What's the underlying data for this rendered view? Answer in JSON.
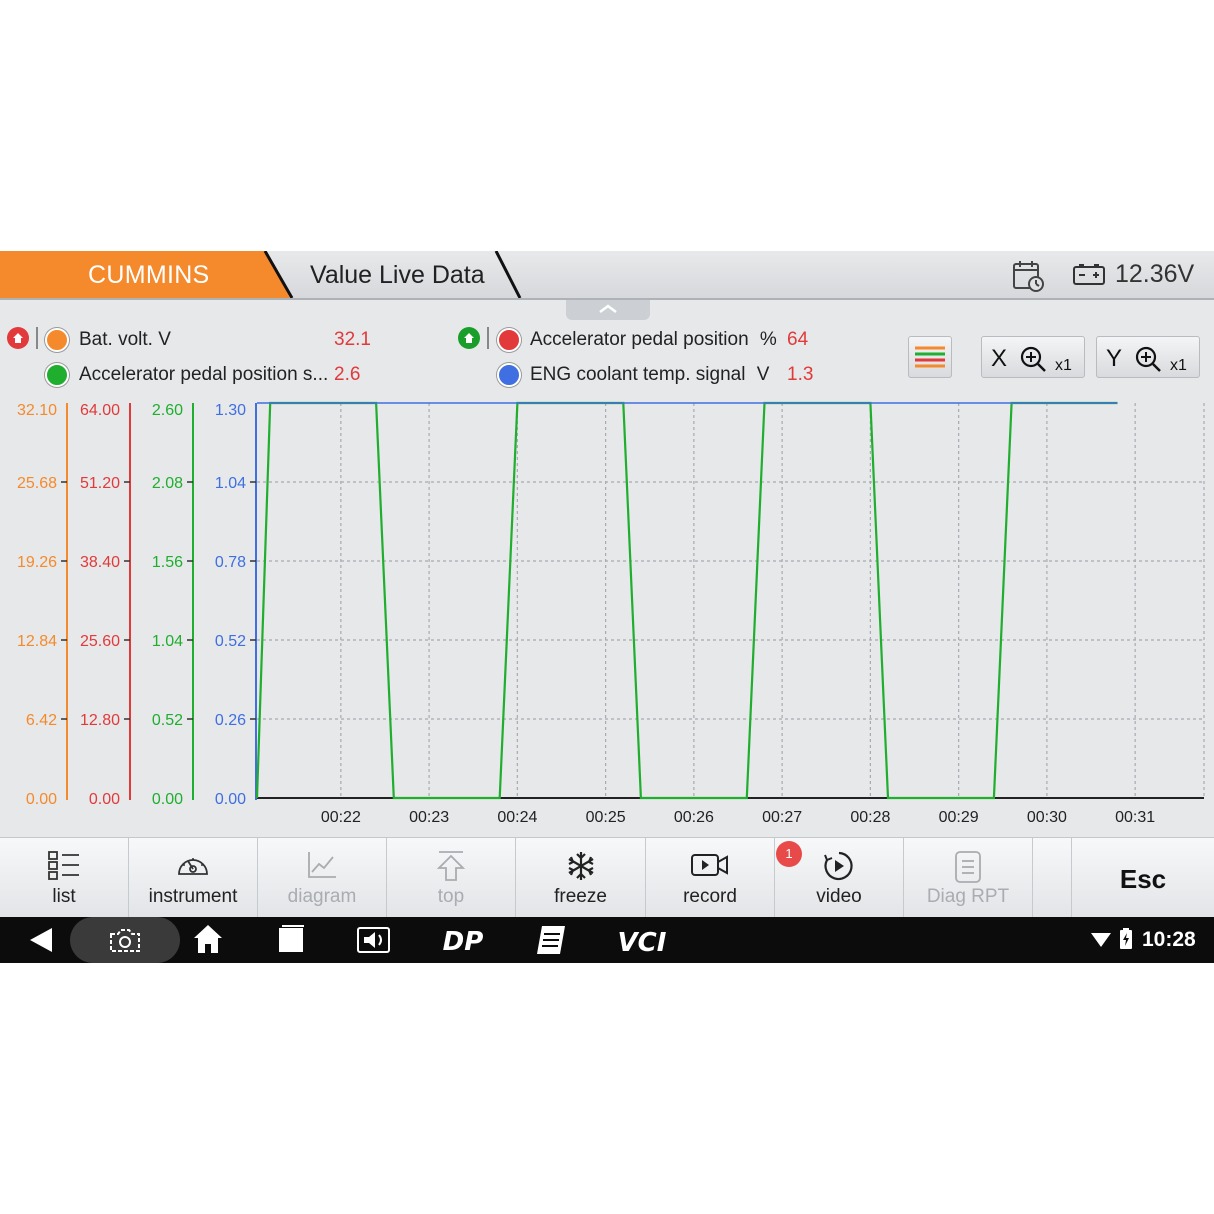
{
  "header": {
    "brand": "CUMMINS",
    "title": "Value Live Data",
    "battery_voltage": "12.36V",
    "brand_color": "#f58a2c"
  },
  "legend": [
    {
      "name": "Bat. volt.",
      "unit": "V",
      "value": "32.1",
      "color": "#f58a2c"
    },
    {
      "name": "Accelerator pedal position",
      "unit": "%",
      "value": "64",
      "color": "#e23a3a"
    },
    {
      "name": "Accelerator pedal position s...",
      "unit": "",
      "value": "2.6",
      "color": "#1fae2e"
    },
    {
      "name": "ENG coolant temp. signal",
      "unit": "V",
      "value": "1.3",
      "color": "#3f6fe0"
    }
  ],
  "zoom": {
    "x": {
      "axis": "X",
      "multiplier": "x1"
    },
    "y": {
      "axis": "Y",
      "multiplier": "x1"
    }
  },
  "chart_data": {
    "type": "line",
    "x_ticks": [
      "00:22",
      "00:23",
      "00:24",
      "00:25",
      "00:26",
      "00:27",
      "00:28",
      "00:29",
      "00:30",
      "00:31"
    ],
    "axes": [
      {
        "series": "Bat. volt.",
        "color": "#f58a2c",
        "ticks": [
          "32.10",
          "25.68",
          "19.26",
          "12.84",
          "6.42",
          "0.00"
        ],
        "ylim": [
          0,
          32.1
        ]
      },
      {
        "series": "Accelerator pedal position",
        "color": "#e23a3a",
        "ticks": [
          "64.00",
          "51.20",
          "38.40",
          "25.60",
          "12.80",
          "0.00"
        ],
        "ylim": [
          0,
          64
        ]
      },
      {
        "series": "Accelerator pedal position s...",
        "color": "#1fae2e",
        "ticks": [
          "2.60",
          "2.08",
          "1.56",
          "1.04",
          "0.52",
          "0.00"
        ],
        "ylim": [
          0,
          2.6
        ]
      },
      {
        "series": "ENG coolant temp. signal",
        "color": "#3f6fe0",
        "ticks": [
          "1.30",
          "1.04",
          "0.78",
          "0.52",
          "0.26",
          "0.00"
        ],
        "ylim": [
          0,
          1.3
        ]
      }
    ],
    "series": [
      {
        "name": "Accelerator pedal position s...",
        "color": "#1fae2e",
        "x": [
          21.05,
          21.2,
          22.4,
          22.6,
          23.8,
          24.0,
          25.2,
          25.4,
          26.6,
          26.8,
          28.0,
          28.2,
          29.4,
          29.6,
          30.8
        ],
        "values": [
          0.0,
          2.6,
          2.6,
          0.0,
          0.0,
          2.6,
          2.6,
          0.0,
          0.0,
          2.6,
          2.6,
          0.0,
          0.0,
          2.6,
          2.6
        ]
      },
      {
        "name": "ENG coolant temp. signal",
        "color": "#3f6fe0",
        "x": [
          21.05,
          30.8
        ],
        "values": [
          1.3,
          1.3
        ]
      }
    ],
    "xlim": [
      21.05,
      31.78
    ],
    "grid": true
  },
  "toolbar": {
    "items": [
      {
        "label": "list",
        "icon": "list-icon",
        "enabled": true
      },
      {
        "label": "instrument",
        "icon": "gauge-icon",
        "enabled": true
      },
      {
        "label": "diagram",
        "icon": "line-chart-icon",
        "enabled": false
      },
      {
        "label": "top",
        "icon": "arrow-up-icon",
        "enabled": false
      },
      {
        "label": "freeze",
        "icon": "snowflake-icon",
        "enabled": true
      },
      {
        "label": "record",
        "icon": "camera-icon",
        "enabled": true
      },
      {
        "label": "video",
        "icon": "play-circle-icon",
        "enabled": true
      },
      {
        "label": "Diag RPT",
        "icon": "report-icon",
        "enabled": false
      }
    ],
    "esc": "Esc",
    "video_badge": "1"
  },
  "navbar": {
    "clock": "10:28",
    "dp_label": "DP",
    "vci_label": "VCI"
  }
}
